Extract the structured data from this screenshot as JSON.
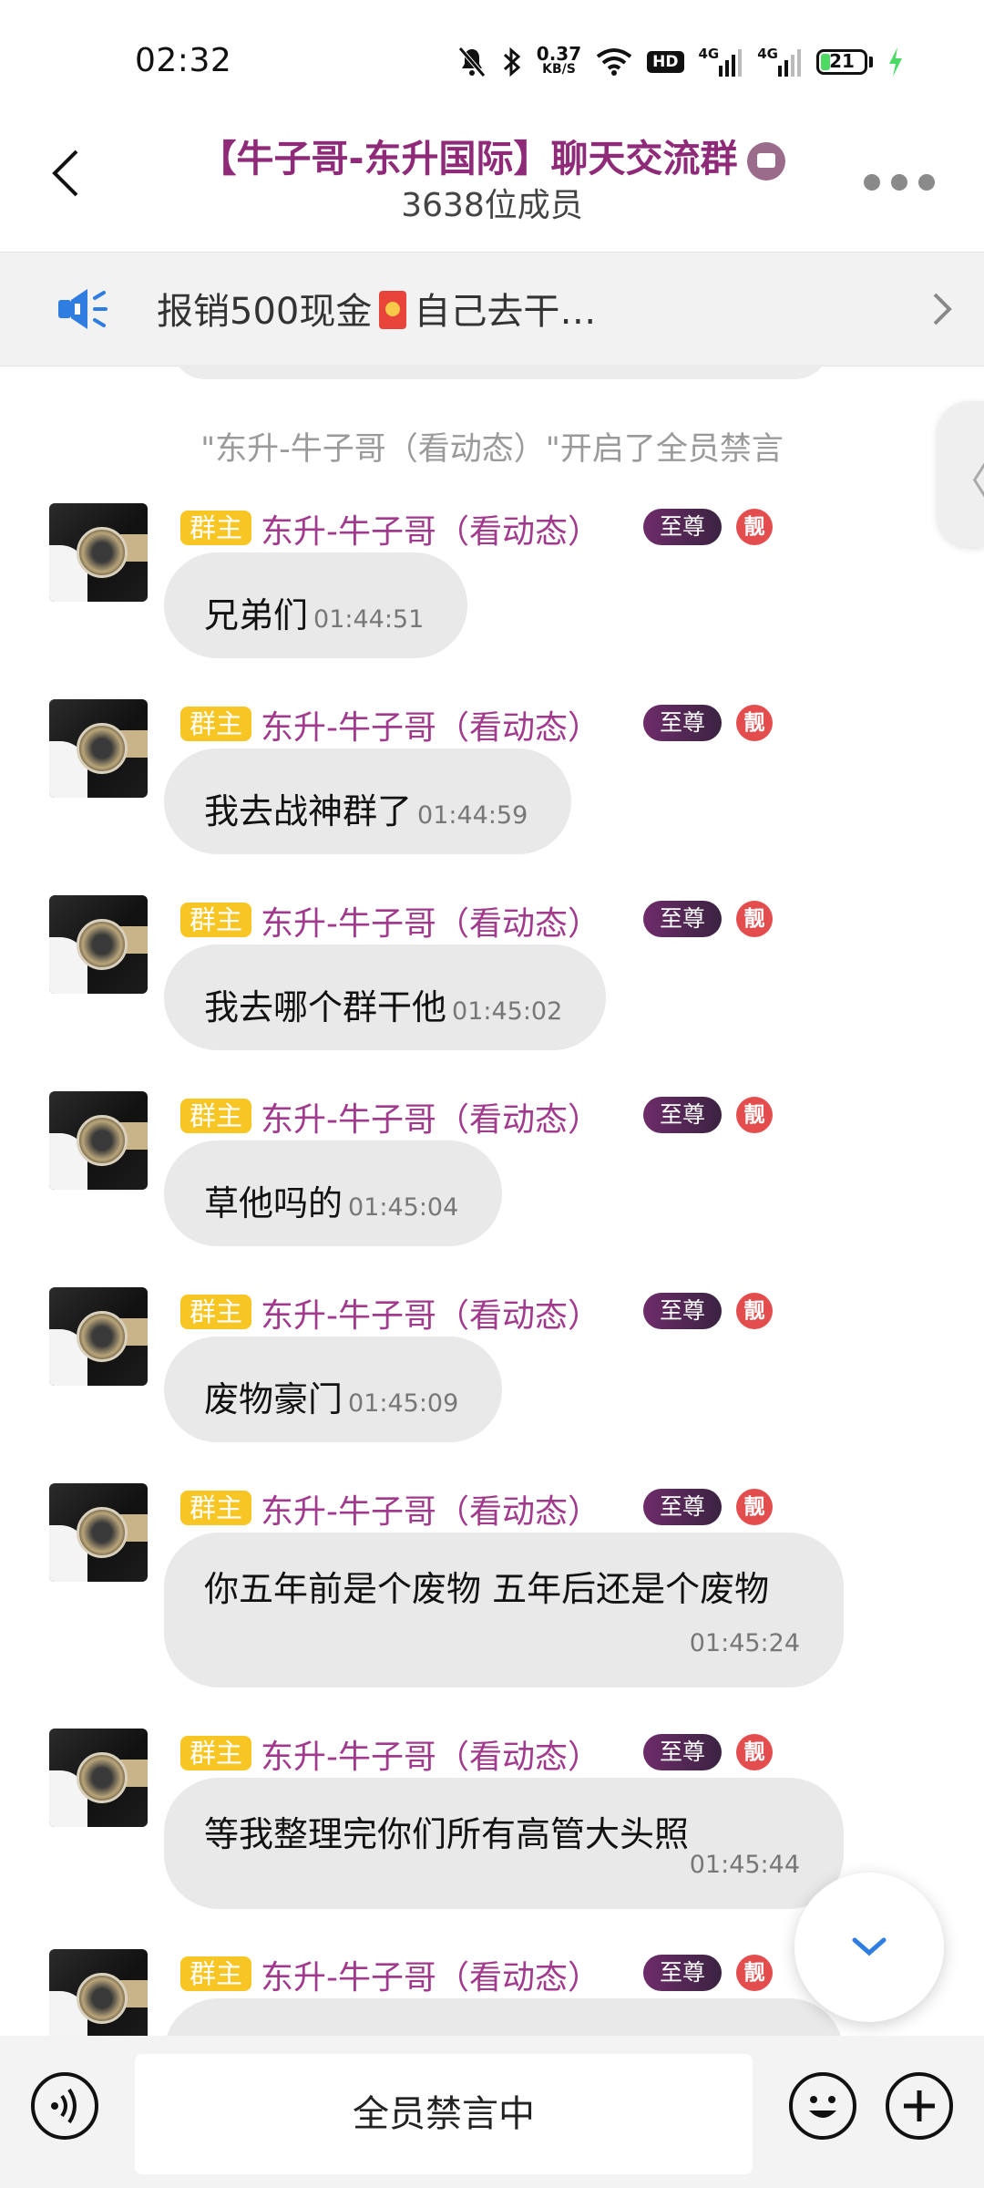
{
  "status_bar": {
    "time": "02:32",
    "net_speed_value": "0.37",
    "net_speed_unit": "KB/S",
    "hd_label": "HD",
    "network_1": "4G",
    "network_2": "4G",
    "battery_level": "21",
    "battery_color": "#4cd964"
  },
  "header": {
    "title": "【牛子哥-东升国际】聊天交流群",
    "member_count": "3638位成员",
    "title_color": "#8e2a78"
  },
  "announcement": {
    "text_before": "报销500现金",
    "text_after": "自己去干…"
  },
  "chat": {
    "system_notice": "\"东升-牛子哥（看动态）\"开启了全员禁言",
    "messages": [
      {
        "role": "群主",
        "sender": "东升-牛子哥（看动态）",
        "rank": "至尊",
        "tag": "靓",
        "text": "兄弟们",
        "time": "01:44:51"
      },
      {
        "role": "群主",
        "sender": "东升-牛子哥（看动态）",
        "rank": "至尊",
        "tag": "靓",
        "text": "我去战神群了",
        "time": "01:44:59"
      },
      {
        "role": "群主",
        "sender": "东升-牛子哥（看动态）",
        "rank": "至尊",
        "tag": "靓",
        "text": "我去哪个群干他",
        "time": "01:45:02"
      },
      {
        "role": "群主",
        "sender": "东升-牛子哥（看动态）",
        "rank": "至尊",
        "tag": "靓",
        "text": "草他吗的",
        "time": "01:45:04"
      },
      {
        "role": "群主",
        "sender": "东升-牛子哥（看动态）",
        "rank": "至尊",
        "tag": "靓",
        "text": "废物豪门",
        "time": "01:45:09"
      },
      {
        "role": "群主",
        "sender": "东升-牛子哥（看动态）",
        "rank": "至尊",
        "tag": "靓",
        "text": "你五年前是个废物 五年后还是个废物",
        "time": "01:45:24"
      },
      {
        "role": "群主",
        "sender": "东升-牛子哥（看动态）",
        "rank": "至尊",
        "tag": "靓",
        "text": "等我整理完你们所有高管大头照",
        "time": "01:45:44"
      },
      {
        "role": "群主",
        "sender": "东升-牛子哥（看动态）",
        "rank": "至尊",
        "tag": "靓"
      }
    ]
  },
  "bottom_bar": {
    "input_status": "全员禁言中"
  }
}
